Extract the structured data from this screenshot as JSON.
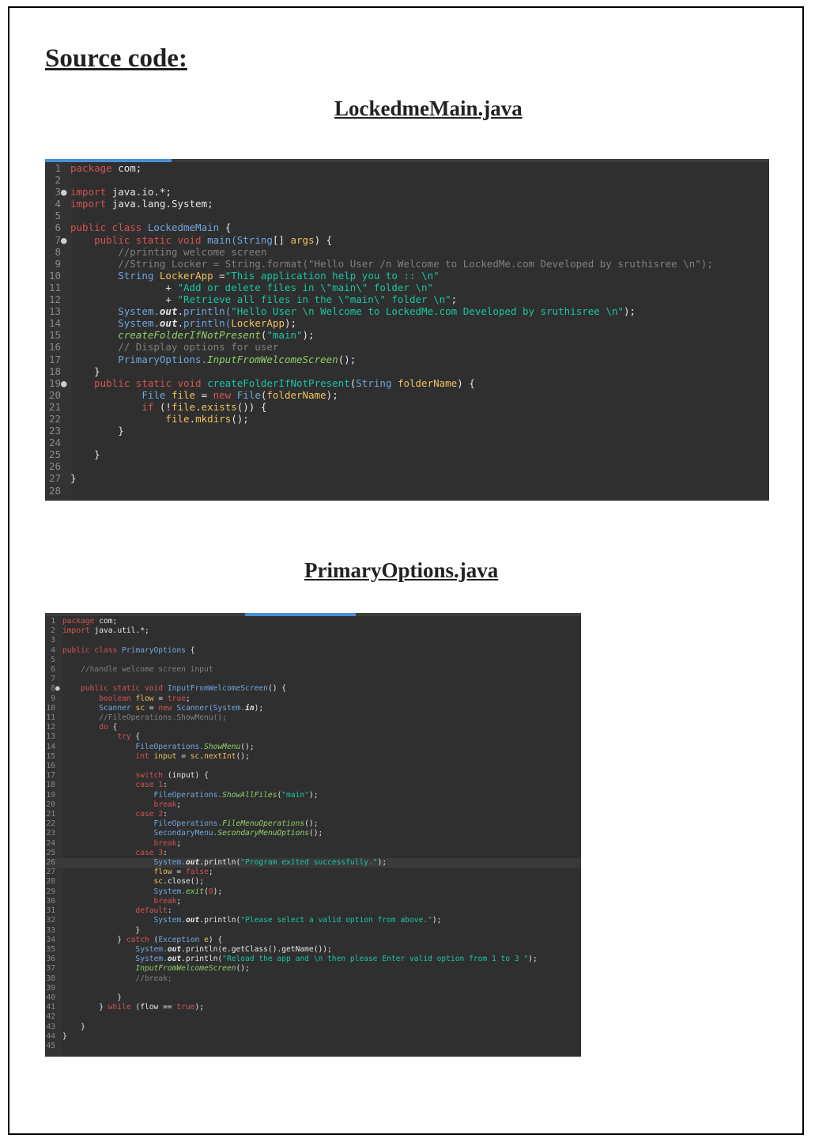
{
  "heading": "Source code:",
  "files": [
    {
      "title": "LockedmeMain.java",
      "lines": [
        [
          [
            "kw",
            "package "
          ],
          [
            "p",
            "com;"
          ]
        ],
        [],
        [
          [
            "kw",
            "import "
          ],
          [
            "p",
            "java.io.*;"
          ]
        ],
        [
          [
            "kw",
            "import "
          ],
          [
            "p",
            "java.lang.System;"
          ]
        ],
        [],
        [
          [
            "kw",
            "public class "
          ],
          [
            "ty",
            "LockedmeMain "
          ],
          [
            "p",
            "{"
          ]
        ],
        [
          [
            "p",
            "    "
          ],
          [
            "kw",
            "public static void "
          ],
          [
            "ty",
            "main("
          ],
          [
            "ty",
            "String"
          ],
          [
            "p",
            "[] "
          ],
          [
            "var",
            "args"
          ],
          [
            "p",
            ") {"
          ]
        ],
        [
          [
            "cm",
            "        //printing welcome screen"
          ]
        ],
        [
          [
            "cm",
            "        //String Locker = String.format(\"Hello User /n Welcome to LockedMe.com Developed by sruthisree \\n\");"
          ]
        ],
        [
          [
            "p",
            "        "
          ],
          [
            "ty",
            "String "
          ],
          [
            "var",
            "LockerApp "
          ],
          [
            "p",
            "="
          ],
          [
            "str",
            "\"This application help you to :: \\n\""
          ]
        ],
        [
          [
            "p",
            "                + "
          ],
          [
            "str",
            "\"Add or delete files in \\\"main\\\" folder \\n\""
          ]
        ],
        [
          [
            "p",
            "                + "
          ],
          [
            "str",
            "\"Retrieve all files in the \\\"main\\\" folder \\n\""
          ],
          [
            "p",
            ";"
          ]
        ],
        [
          [
            "p",
            "        "
          ],
          [
            "ty",
            "System."
          ],
          [
            "stat",
            "out"
          ],
          [
            "p",
            "."
          ],
          [
            "ty",
            "println("
          ],
          [
            "str",
            "\"Hello User \\n Welcome to LockedMe.com Developed by sruthisree \\n\""
          ],
          [
            "p",
            ");"
          ]
        ],
        [
          [
            "p",
            "        "
          ],
          [
            "ty",
            "System."
          ],
          [
            "stat",
            "out"
          ],
          [
            "p",
            "."
          ],
          [
            "ty",
            "println("
          ],
          [
            "var",
            "LockerApp"
          ],
          [
            "p",
            ");"
          ]
        ],
        [
          [
            "p",
            "        "
          ],
          [
            "it",
            "createFolderIfNotPresent"
          ],
          [
            "p",
            "("
          ],
          [
            "str",
            "\"main\""
          ],
          [
            "p",
            ");"
          ]
        ],
        [
          [
            "cm",
            "        // Display options for user"
          ]
        ],
        [
          [
            "p",
            "        "
          ],
          [
            "ty",
            "PrimaryOptions."
          ],
          [
            "it",
            "InputFromWelcomeScreen"
          ],
          [
            "p",
            "();"
          ]
        ],
        [
          [
            "p",
            "    }"
          ]
        ],
        [
          [
            "p",
            "    "
          ],
          [
            "kw",
            "public static void "
          ],
          [
            "str",
            "createFolderIfNotPresent"
          ],
          [
            "p",
            "("
          ],
          [
            "ty",
            "String "
          ],
          [
            "var",
            "folderName"
          ],
          [
            "p",
            ") {"
          ]
        ],
        [
          [
            "p",
            "            "
          ],
          [
            "ty",
            "File "
          ],
          [
            "var",
            "file "
          ],
          [
            "p",
            "= "
          ],
          [
            "kw",
            "new "
          ],
          [
            "ty",
            "File"
          ],
          [
            "p",
            "("
          ],
          [
            "var",
            "folderName"
          ],
          [
            "p",
            ");"
          ]
        ],
        [
          [
            "p",
            "            "
          ],
          [
            "kw",
            "if "
          ],
          [
            "p",
            "(!"
          ],
          [
            "var",
            "file"
          ],
          [
            "p",
            "."
          ],
          [
            "var",
            "exists"
          ],
          [
            "p",
            "()) {"
          ]
        ],
        [
          [
            "p",
            "                "
          ],
          [
            "var",
            "file"
          ],
          [
            "p",
            "."
          ],
          [
            "var",
            "mkdirs"
          ],
          [
            "p",
            "();"
          ]
        ],
        [
          [
            "p",
            "        }"
          ]
        ],
        [],
        [
          [
            "p",
            "    }"
          ]
        ],
        [],
        [
          [
            "p",
            "}"
          ]
        ],
        []
      ],
      "markers": [
        3,
        7,
        19
      ]
    },
    {
      "title": "PrimaryOptions.java",
      "lines": [
        [
          [
            "kw",
            "package "
          ],
          [
            "p",
            "com;"
          ]
        ],
        [
          [
            "kw",
            "import "
          ],
          [
            "p",
            "java.util.*;"
          ]
        ],
        [],
        [
          [
            "kw",
            "public class "
          ],
          [
            "ty",
            "PrimaryOptions "
          ],
          [
            "p",
            "{"
          ]
        ],
        [],
        [
          [
            "cm",
            "    //handle welcome screen input"
          ]
        ],
        [],
        [
          [
            "p",
            "    "
          ],
          [
            "kw",
            "public static void "
          ],
          [
            "ty",
            "InputFromWelcomeScreen"
          ],
          [
            "p",
            "() {"
          ]
        ],
        [
          [
            "p",
            "        "
          ],
          [
            "kw",
            "boolean "
          ],
          [
            "var",
            "flow "
          ],
          [
            "p",
            "= "
          ],
          [
            "kw",
            "true"
          ],
          [
            "p",
            ";"
          ]
        ],
        [
          [
            "p",
            "        "
          ],
          [
            "ty",
            "Scanner "
          ],
          [
            "var",
            "sc "
          ],
          [
            "p",
            "= "
          ],
          [
            "kw",
            "new "
          ],
          [
            "ty",
            "Scanner("
          ],
          [
            "ty",
            "System."
          ],
          [
            "stat",
            "in"
          ],
          [
            "p",
            ");"
          ]
        ],
        [
          [
            "cm",
            "        //FileOperations.ShowMenu();"
          ]
        ],
        [
          [
            "p",
            "        "
          ],
          [
            "kw",
            "do "
          ],
          [
            "p",
            "{"
          ]
        ],
        [
          [
            "p",
            "            "
          ],
          [
            "kw",
            "try "
          ],
          [
            "p",
            "{"
          ]
        ],
        [
          [
            "p",
            "                "
          ],
          [
            "ty",
            "FileOperations."
          ],
          [
            "it",
            "ShowMenu"
          ],
          [
            "p",
            "();"
          ]
        ],
        [
          [
            "p",
            "                "
          ],
          [
            "kw",
            "int "
          ],
          [
            "var",
            "input "
          ],
          [
            "p",
            "= "
          ],
          [
            "var",
            "sc"
          ],
          [
            "p",
            "."
          ],
          [
            "var",
            "nextInt"
          ],
          [
            "p",
            "();"
          ]
        ],
        [],
        [
          [
            "p",
            "                "
          ],
          [
            "kw",
            "switch "
          ],
          [
            "p",
            "(input) {"
          ]
        ],
        [
          [
            "p",
            "                "
          ],
          [
            "kw",
            "case "
          ],
          [
            "num",
            "1"
          ],
          [
            "p",
            ":"
          ]
        ],
        [
          [
            "p",
            "                    "
          ],
          [
            "ty",
            "FileOperations."
          ],
          [
            "it",
            "ShowAllFiles"
          ],
          [
            "p",
            "("
          ],
          [
            "str",
            "\"main\""
          ],
          [
            "p",
            ");"
          ]
        ],
        [
          [
            "p",
            "                    "
          ],
          [
            "kw",
            "break"
          ],
          [
            "p",
            ";"
          ]
        ],
        [
          [
            "p",
            "                "
          ],
          [
            "kw",
            "case "
          ],
          [
            "num",
            "2"
          ],
          [
            "p",
            ":"
          ]
        ],
        [
          [
            "p",
            "                    "
          ],
          [
            "ty",
            "FileOperations."
          ],
          [
            "it",
            "FileMenuOperations"
          ],
          [
            "p",
            "();"
          ]
        ],
        [
          [
            "p",
            "                    "
          ],
          [
            "ty",
            "SecondaryMenu."
          ],
          [
            "it",
            "SecondaryMenuOptions"
          ],
          [
            "p",
            "();"
          ]
        ],
        [
          [
            "p",
            "                    "
          ],
          [
            "kw",
            "break"
          ],
          [
            "p",
            ";"
          ]
        ],
        [
          [
            "p",
            "                "
          ],
          [
            "kw",
            "case "
          ],
          [
            "num",
            "3"
          ],
          [
            "p",
            ":"
          ]
        ],
        [
          [
            "p",
            "                    "
          ],
          [
            "ty",
            "System."
          ],
          [
            "stat",
            "out"
          ],
          [
            "p",
            ".println("
          ],
          [
            "str",
            "\"Program exited successfully.\""
          ],
          [
            "p",
            ");"
          ]
        ],
        [
          [
            "p",
            "                    "
          ],
          [
            "var",
            "flow "
          ],
          [
            "p",
            "= "
          ],
          [
            "kw",
            "false"
          ],
          [
            "p",
            ";"
          ]
        ],
        [
          [
            "p",
            "                    "
          ],
          [
            "var",
            "sc"
          ],
          [
            "p",
            ".close();"
          ]
        ],
        [
          [
            "p",
            "                    "
          ],
          [
            "ty",
            "System."
          ],
          [
            "it",
            "exit"
          ],
          [
            "p",
            "("
          ],
          [
            "num",
            "0"
          ],
          [
            "p",
            ");"
          ]
        ],
        [
          [
            "p",
            "                    "
          ],
          [
            "kw",
            "break"
          ],
          [
            "p",
            ";"
          ]
        ],
        [
          [
            "p",
            "                "
          ],
          [
            "kw",
            "default"
          ],
          [
            "p",
            ":"
          ]
        ],
        [
          [
            "p",
            "                    "
          ],
          [
            "ty",
            "System."
          ],
          [
            "stat",
            "out"
          ],
          [
            "p",
            ".println("
          ],
          [
            "str",
            "\"Please select a valid option from above.\""
          ],
          [
            "p",
            ");"
          ]
        ],
        [
          [
            "p",
            "                }"
          ]
        ],
        [
          [
            "p",
            "            } "
          ],
          [
            "kw",
            "catch "
          ],
          [
            "p",
            "("
          ],
          [
            "ty",
            "Exception "
          ],
          [
            "var",
            "e"
          ],
          [
            "p",
            ") {"
          ]
        ],
        [
          [
            "p",
            "                "
          ],
          [
            "ty",
            "System."
          ],
          [
            "stat",
            "out"
          ],
          [
            "p",
            ".println(e.getClass().getName());"
          ]
        ],
        [
          [
            "p",
            "                "
          ],
          [
            "ty",
            "System."
          ],
          [
            "stat",
            "out"
          ],
          [
            "p",
            ".println("
          ],
          [
            "str",
            "\"Reload the app and \\n then please Enter valid option from 1 to 3 \""
          ],
          [
            "p",
            ");"
          ]
        ],
        [
          [
            "p",
            "                "
          ],
          [
            "it",
            "InputFromWelcomeScreen"
          ],
          [
            "p",
            "();"
          ]
        ],
        [
          [
            "cm",
            "                //break;"
          ]
        ],
        [],
        [
          [
            "p",
            "            }"
          ]
        ],
        [
          [
            "p",
            "        } "
          ],
          [
            "kw",
            "while "
          ],
          [
            "p",
            "(flow == "
          ],
          [
            "kw",
            "true"
          ],
          [
            "p",
            ");"
          ]
        ],
        [],
        [
          [
            "p",
            "    }"
          ]
        ],
        [
          [
            "p",
            "}"
          ]
        ],
        []
      ],
      "markers": [
        8
      ],
      "highlight": 26
    }
  ]
}
